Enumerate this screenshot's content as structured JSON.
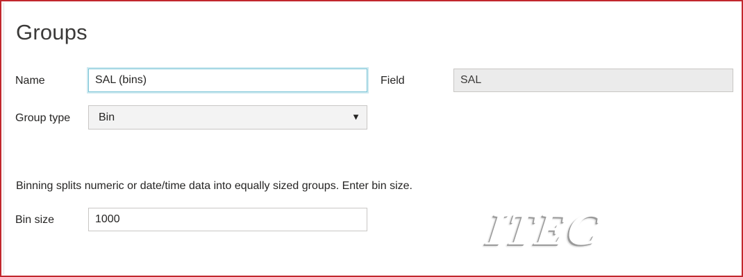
{
  "dialog": {
    "title": "Groups"
  },
  "form": {
    "name": {
      "label": "Name",
      "value": "SAL (bins)"
    },
    "field": {
      "label": "Field",
      "value": "SAL"
    },
    "group_type": {
      "label": "Group type",
      "selected": "Bin",
      "caret": "▼"
    },
    "description": "Binning splits numeric or date/time data into equally sized groups. Enter bin size.",
    "bin_size": {
      "label": "Bin size",
      "value": "1000"
    }
  },
  "watermark": {
    "text": "ITEC"
  },
  "colors": {
    "frame_border": "#c1272d",
    "focus_ring": "#7ac4d6",
    "readonly_bg": "#ebebeb"
  }
}
